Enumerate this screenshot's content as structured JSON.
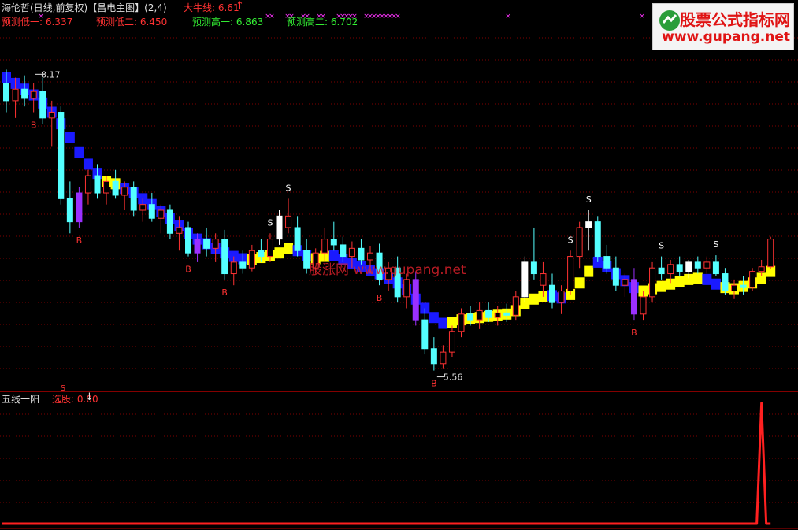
{
  "header": {
    "title": "海伦哲(日线,前复权)【昌电主图】(2,4)",
    "niu_label": "大牛线: 6.61",
    "pred_low1": "预测低一: 6.337",
    "pred_low2": "预测低二: 6.450",
    "pred_high1": "预测高一: 6.863",
    "pred_high2": "预测高二: 6.702"
  },
  "logo": {
    "line1": "股票公式指标网",
    "line2": "www.gupang.net"
  },
  "watermark": "股涨网 www.gupang.net",
  "sub_panel": {
    "title": "五线一阳",
    "select_label": "选股: 0.00"
  },
  "colors": {
    "up": "#ff3232",
    "down": "#54ffff",
    "trend_down": "#1a1aff",
    "trend_up": "#ffff00",
    "purple": "#9b30ff",
    "white": "#ffffff",
    "axis": "#b00000",
    "grid": "#800000"
  },
  "chart_data": {
    "type": "candlestick",
    "main": {
      "price_high_label": "8.17",
      "price_low_label": "5.56",
      "ylim": [
        5.4,
        8.5
      ],
      "candles": [
        [
          8.05,
          8.17,
          7.8,
          7.9,
          "down"
        ],
        [
          7.9,
          8.1,
          7.75,
          8.0,
          "up"
        ],
        [
          8.0,
          8.12,
          7.85,
          7.92,
          "down"
        ],
        [
          7.92,
          8.05,
          7.8,
          7.98,
          "up"
        ],
        [
          7.98,
          8.1,
          7.7,
          7.75,
          "down"
        ],
        [
          7.75,
          7.9,
          7.5,
          7.8,
          "up"
        ],
        [
          7.8,
          7.85,
          7.0,
          7.05,
          "down"
        ],
        [
          7.05,
          7.2,
          6.75,
          6.85,
          "down"
        ],
        [
          6.85,
          7.15,
          6.8,
          7.1,
          "purple"
        ],
        [
          7.1,
          7.3,
          7.0,
          7.25,
          "up"
        ],
        [
          7.25,
          7.35,
          7.05,
          7.1,
          "down"
        ],
        [
          7.1,
          7.25,
          7.0,
          7.2,
          "up"
        ],
        [
          7.2,
          7.3,
          7.05,
          7.08,
          "down"
        ],
        [
          7.08,
          7.2,
          6.95,
          7.15,
          "up"
        ],
        [
          7.15,
          7.2,
          6.9,
          6.95,
          "down"
        ],
        [
          6.95,
          7.05,
          6.85,
          7.0,
          "up"
        ],
        [
          7.0,
          7.1,
          6.85,
          6.88,
          "down"
        ],
        [
          6.88,
          7.0,
          6.75,
          6.95,
          "up"
        ],
        [
          6.95,
          7.0,
          6.7,
          6.75,
          "down"
        ],
        [
          6.75,
          6.9,
          6.6,
          6.8,
          "up"
        ],
        [
          6.8,
          6.85,
          6.55,
          6.58,
          "down"
        ],
        [
          6.58,
          6.75,
          6.5,
          6.7,
          "purple"
        ],
        [
          6.7,
          6.8,
          6.55,
          6.62,
          "down"
        ],
        [
          6.62,
          6.75,
          6.5,
          6.7,
          "up"
        ],
        [
          6.7,
          6.78,
          6.35,
          6.4,
          "down"
        ],
        [
          6.4,
          6.55,
          6.3,
          6.5,
          "up"
        ],
        [
          6.5,
          6.6,
          6.4,
          6.45,
          "down"
        ],
        [
          6.45,
          6.65,
          6.42,
          6.6,
          "up"
        ],
        [
          6.6,
          6.7,
          6.5,
          6.55,
          "down"
        ],
        [
          6.55,
          6.75,
          6.5,
          6.7,
          "up"
        ],
        [
          6.7,
          6.95,
          6.65,
          6.9,
          "white"
        ],
        [
          6.9,
          7.05,
          6.75,
          6.8,
          "up"
        ],
        [
          6.8,
          6.9,
          6.55,
          6.6,
          "down"
        ],
        [
          6.6,
          6.7,
          6.4,
          6.45,
          "down"
        ],
        [
          6.45,
          6.62,
          6.4,
          6.58,
          "up"
        ],
        [
          6.58,
          6.8,
          6.5,
          6.7,
          "up"
        ],
        [
          6.7,
          6.85,
          6.6,
          6.65,
          "down"
        ],
        [
          6.65,
          6.72,
          6.5,
          6.55,
          "down"
        ],
        [
          6.55,
          6.68,
          6.45,
          6.62,
          "up"
        ],
        [
          6.62,
          6.7,
          6.48,
          6.52,
          "down"
        ],
        [
          6.52,
          6.64,
          6.4,
          6.58,
          "up"
        ],
        [
          6.58,
          6.66,
          6.3,
          6.35,
          "down"
        ],
        [
          6.35,
          6.5,
          6.25,
          6.45,
          "up"
        ],
        [
          6.45,
          6.55,
          6.15,
          6.2,
          "down"
        ],
        [
          6.2,
          6.4,
          6.1,
          6.35,
          "up"
        ],
        [
          6.35,
          6.42,
          5.95,
          6.0,
          "purple"
        ],
        [
          6.0,
          6.1,
          5.7,
          5.75,
          "down"
        ],
        [
          5.75,
          5.85,
          5.56,
          5.62,
          "down"
        ],
        [
          5.62,
          5.78,
          5.58,
          5.72,
          "up"
        ],
        [
          5.72,
          5.95,
          5.68,
          5.9,
          "up"
        ],
        [
          5.9,
          6.1,
          5.85,
          6.05,
          "up"
        ],
        [
          6.05,
          6.12,
          5.95,
          6.0,
          "down"
        ],
        [
          6.0,
          6.15,
          5.92,
          6.08,
          "up"
        ],
        [
          6.08,
          6.15,
          5.98,
          6.02,
          "down"
        ],
        [
          6.02,
          6.12,
          5.95,
          6.06,
          "up"
        ],
        [
          6.06,
          6.14,
          5.98,
          6.04,
          "down"
        ],
        [
          6.04,
          6.25,
          6.0,
          6.2,
          "up"
        ],
        [
          6.2,
          6.55,
          6.15,
          6.5,
          "white"
        ],
        [
          6.5,
          6.8,
          6.35,
          6.4,
          "down"
        ],
        [
          6.4,
          6.5,
          6.2,
          6.3,
          "up"
        ],
        [
          6.3,
          6.4,
          6.1,
          6.15,
          "down"
        ],
        [
          6.15,
          6.3,
          6.05,
          6.25,
          "up"
        ],
        [
          6.25,
          6.6,
          6.22,
          6.55,
          "up"
        ],
        [
          6.55,
          6.85,
          6.45,
          6.8,
          "up"
        ],
        [
          6.8,
          6.95,
          6.6,
          6.85,
          "white"
        ],
        [
          6.85,
          6.9,
          6.5,
          6.55,
          "down"
        ],
        [
          6.55,
          6.65,
          6.4,
          6.45,
          "down"
        ],
        [
          6.45,
          6.55,
          6.25,
          6.3,
          "down"
        ],
        [
          6.3,
          6.4,
          6.2,
          6.35,
          "up"
        ],
        [
          6.35,
          6.45,
          6.0,
          6.05,
          "purple"
        ],
        [
          6.05,
          6.25,
          6.0,
          6.2,
          "up"
        ],
        [
          6.2,
          6.5,
          6.15,
          6.45,
          "up"
        ],
        [
          6.45,
          6.55,
          6.35,
          6.4,
          "down"
        ],
        [
          6.4,
          6.52,
          6.32,
          6.48,
          "up"
        ],
        [
          6.48,
          6.55,
          6.38,
          6.42,
          "down"
        ],
        [
          6.42,
          6.52,
          6.36,
          6.5,
          "white"
        ],
        [
          6.5,
          6.55,
          6.4,
          6.45,
          "down"
        ],
        [
          6.45,
          6.55,
          6.4,
          6.5,
          "up"
        ],
        [
          6.5,
          6.56,
          6.38,
          6.4,
          "down"
        ],
        [
          6.4,
          6.45,
          6.22,
          6.25,
          "down"
        ],
        [
          6.25,
          6.35,
          6.18,
          6.3,
          "up"
        ],
        [
          6.3,
          6.38,
          6.22,
          6.28,
          "down"
        ],
        [
          6.28,
          6.45,
          6.25,
          6.42,
          "up"
        ],
        [
          6.42,
          6.52,
          6.38,
          6.46,
          "up"
        ],
        [
          6.46,
          6.72,
          6.44,
          6.7,
          "up"
        ]
      ],
      "trend": [
        [
          8.1,
          "down"
        ],
        [
          8.05,
          "down"
        ],
        [
          8.0,
          "down"
        ],
        [
          7.95,
          "down"
        ],
        [
          7.88,
          "down"
        ],
        [
          7.8,
          "down"
        ],
        [
          7.7,
          "down"
        ],
        [
          7.58,
          "down"
        ],
        [
          7.45,
          "down"
        ],
        [
          7.35,
          "down"
        ],
        [
          7.27,
          "down"
        ],
        [
          7.2,
          "up"
        ],
        [
          7.18,
          "up"
        ],
        [
          7.14,
          "down"
        ],
        [
          7.1,
          "down"
        ],
        [
          7.05,
          "down"
        ],
        [
          7.0,
          "down"
        ],
        [
          6.94,
          "down"
        ],
        [
          6.88,
          "down"
        ],
        [
          6.82,
          "down"
        ],
        [
          6.75,
          "down"
        ],
        [
          6.7,
          "down"
        ],
        [
          6.66,
          "down"
        ],
        [
          6.62,
          "down"
        ],
        [
          6.58,
          "down"
        ],
        [
          6.55,
          "down"
        ],
        [
          6.53,
          "down"
        ],
        [
          6.52,
          "up"
        ],
        [
          6.54,
          "up"
        ],
        [
          6.56,
          "up"
        ],
        [
          6.58,
          "up"
        ],
        [
          6.62,
          "up"
        ],
        [
          6.6,
          "down"
        ],
        [
          6.56,
          "down"
        ],
        [
          6.53,
          "up"
        ],
        [
          6.55,
          "up"
        ],
        [
          6.56,
          "down"
        ],
        [
          6.52,
          "down"
        ],
        [
          6.49,
          "down"
        ],
        [
          6.46,
          "down"
        ],
        [
          6.43,
          "down"
        ],
        [
          6.4,
          "down"
        ],
        [
          6.36,
          "down"
        ],
        [
          6.32,
          "down"
        ],
        [
          6.26,
          "down"
        ],
        [
          6.18,
          "down"
        ],
        [
          6.1,
          "down"
        ],
        [
          6.02,
          "down"
        ],
        [
          5.97,
          "down"
        ],
        [
          5.98,
          "up"
        ],
        [
          6.0,
          "up"
        ],
        [
          6.01,
          "up"
        ],
        [
          6.02,
          "up"
        ],
        [
          6.03,
          "up"
        ],
        [
          6.04,
          "up"
        ],
        [
          6.05,
          "up"
        ],
        [
          6.08,
          "up"
        ],
        [
          6.14,
          "up"
        ],
        [
          6.18,
          "up"
        ],
        [
          6.2,
          "up"
        ],
        [
          6.21,
          "down"
        ],
        [
          6.19,
          "down"
        ],
        [
          6.22,
          "up"
        ],
        [
          6.32,
          "up"
        ],
        [
          6.42,
          "up"
        ],
        [
          6.5,
          "down"
        ],
        [
          6.46,
          "down"
        ],
        [
          6.4,
          "down"
        ],
        [
          6.34,
          "down"
        ],
        [
          6.28,
          "down"
        ],
        [
          6.25,
          "up"
        ],
        [
          6.27,
          "up"
        ],
        [
          6.29,
          "up"
        ],
        [
          6.31,
          "up"
        ],
        [
          6.33,
          "up"
        ],
        [
          6.35,
          "up"
        ],
        [
          6.36,
          "up"
        ],
        [
          6.35,
          "down"
        ],
        [
          6.31,
          "down"
        ],
        [
          6.28,
          "up"
        ],
        [
          6.27,
          "up"
        ],
        [
          6.29,
          "up"
        ],
        [
          6.32,
          "up"
        ],
        [
          6.36,
          "up"
        ],
        [
          6.42,
          "up"
        ]
      ],
      "signals": [
        {
          "i": 3,
          "text": "B",
          "pos": "below"
        },
        {
          "i": 8,
          "text": "B",
          "pos": "below"
        },
        {
          "i": 20,
          "text": "B",
          "pos": "below"
        },
        {
          "i": 24,
          "text": "B",
          "pos": "below"
        },
        {
          "i": 29,
          "text": "S",
          "pos": "above"
        },
        {
          "i": 31,
          "text": "S",
          "pos": "above"
        },
        {
          "i": 41,
          "text": "B",
          "pos": "below"
        },
        {
          "i": 47,
          "text": "B",
          "pos": "below"
        },
        {
          "i": 62,
          "text": "S",
          "pos": "above"
        },
        {
          "i": 64,
          "text": "S",
          "pos": "above"
        },
        {
          "i": 69,
          "text": "B",
          "pos": "below"
        },
        {
          "i": 72,
          "text": "S",
          "pos": "above"
        },
        {
          "i": 78,
          "text": "S",
          "pos": "above"
        }
      ]
    },
    "sub": {
      "title": "五线一阳",
      "select_value": 0.0,
      "ylim": [
        0,
        1
      ],
      "spike_index": 83,
      "spike_value": 1
    }
  }
}
